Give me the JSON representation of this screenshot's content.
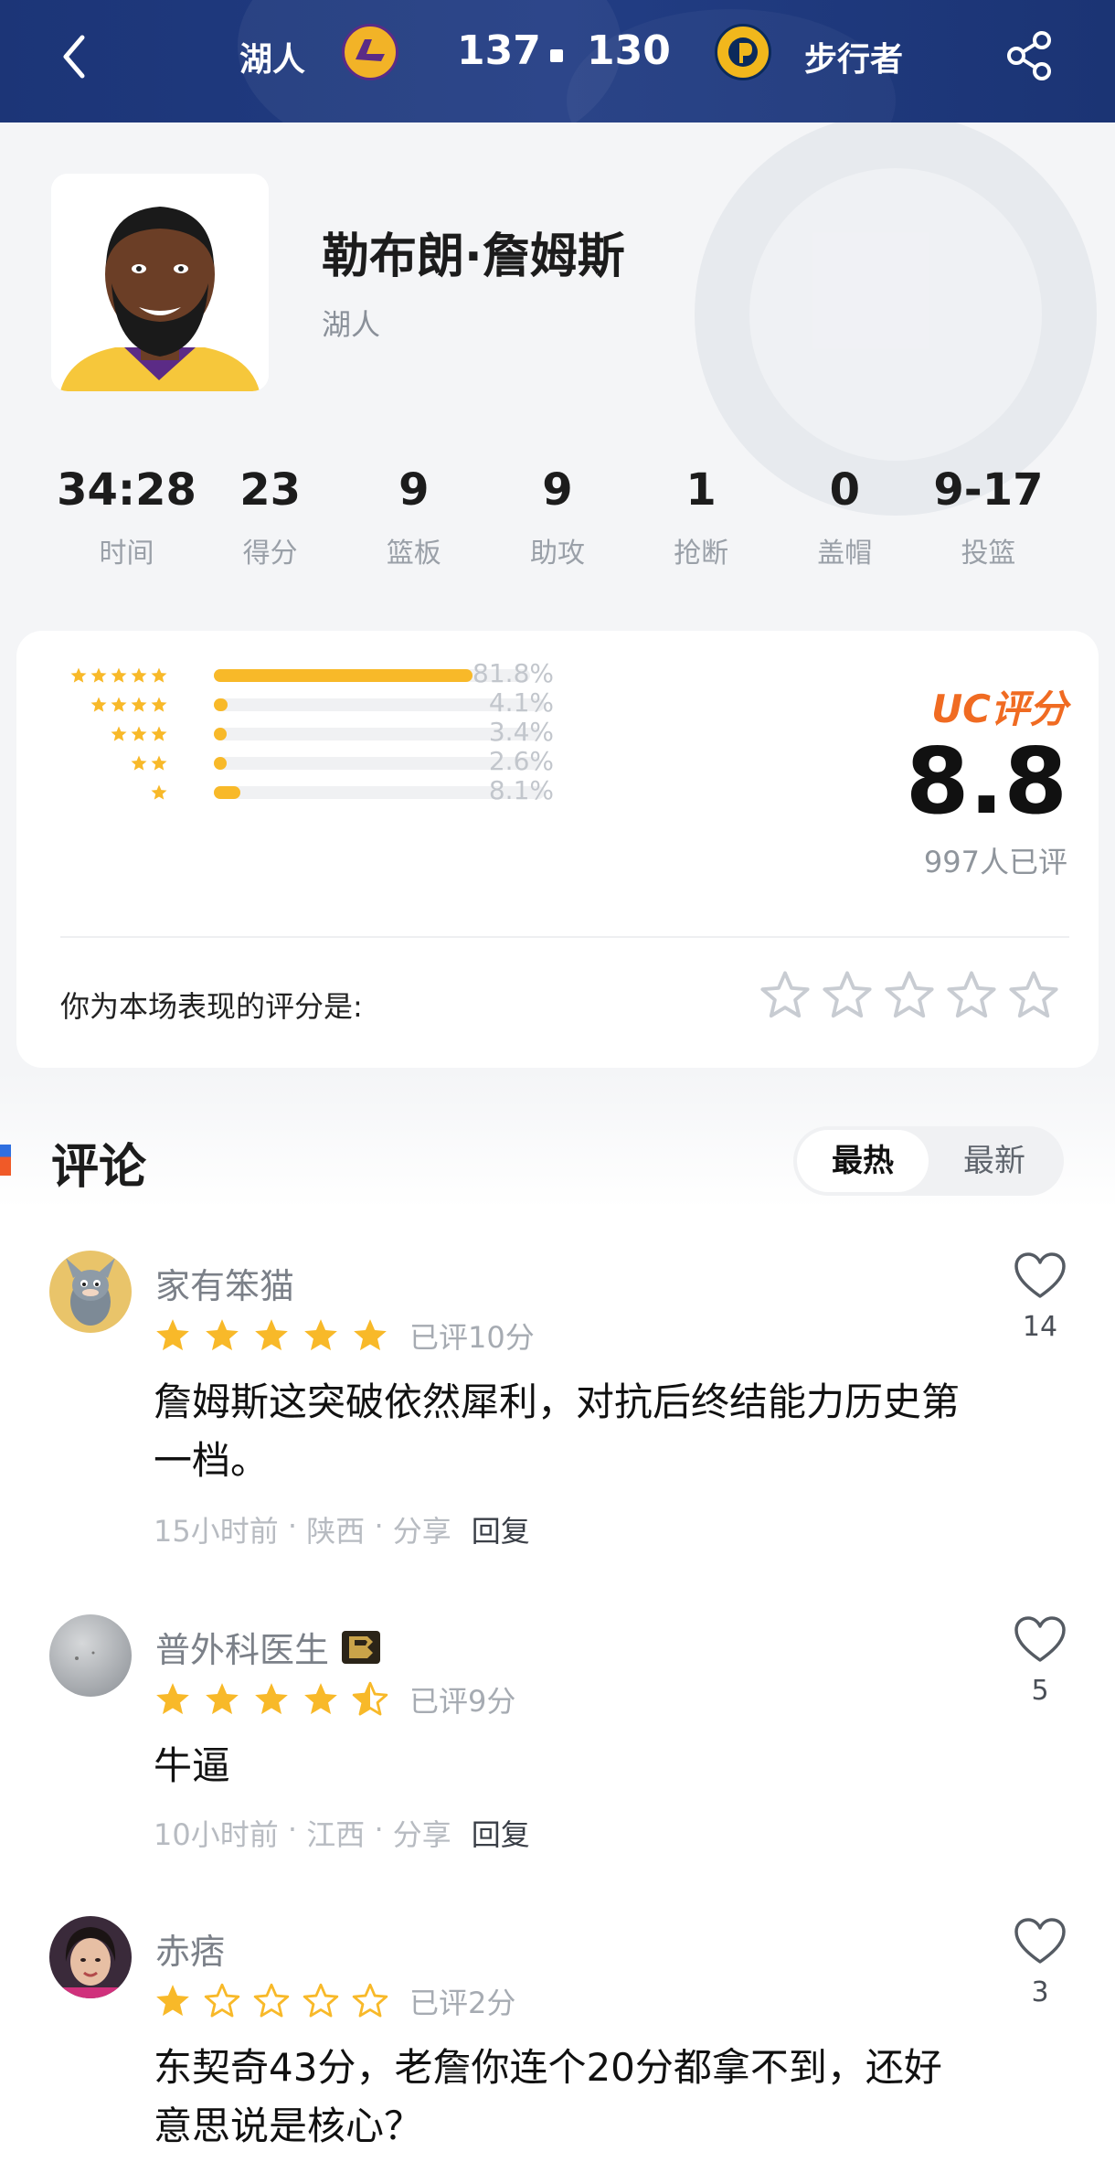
{
  "header": {
    "home_team": "湖人",
    "home_score": "137",
    "away_score": "130",
    "away_team": "步行者"
  },
  "player": {
    "name": "勒布朗·詹姆斯",
    "team": "湖人"
  },
  "stats": [
    {
      "value": "34:28",
      "label": "时间"
    },
    {
      "value": "23",
      "label": "得分"
    },
    {
      "value": "9",
      "label": "篮板"
    },
    {
      "value": "9",
      "label": "助攻"
    },
    {
      "value": "1",
      "label": "抢断"
    },
    {
      "value": "0",
      "label": "盖帽"
    },
    {
      "value": "9-17",
      "label": "投篮"
    }
  ],
  "rating": {
    "title": "UC评分",
    "score": "8.8",
    "count": "997人已评",
    "distribution": [
      {
        "stars": 5,
        "percent": "81.8%",
        "fraction": 0.818
      },
      {
        "stars": 4,
        "percent": "4.1%",
        "fraction": 0.041
      },
      {
        "stars": 3,
        "percent": "3.4%",
        "fraction": 0.034
      },
      {
        "stars": 2,
        "percent": "2.6%",
        "fraction": 0.026
      },
      {
        "stars": 1,
        "percent": "8.1%",
        "fraction": 0.081
      }
    ],
    "your_rating_label": "你为本场表现的评分是:",
    "your_rating_value": 0
  },
  "comments_section": {
    "title": "评论",
    "sort_tabs": [
      "最热",
      "最新"
    ],
    "active_sort": "最热"
  },
  "comments": [
    {
      "user": "家有笨猫",
      "stars": 5,
      "rating_text": "已评10分",
      "body": "詹姆斯这突破依然犀利，对抗后终结能力历史第一档。",
      "time": "15小时前",
      "location": "陕西",
      "share": "分享",
      "reply": "回复",
      "likes": "14"
    },
    {
      "user": "普外科医生",
      "stars": 4.5,
      "rating_text": "已评9分",
      "body": "牛逼",
      "time": "10小时前",
      "location": "江西",
      "share": "分享",
      "reply": "回复",
      "likes": "5"
    },
    {
      "user": "赤痞",
      "stars": 1,
      "rating_text": "已评2分",
      "body": "东契奇43分，老詹你连个20分都拿不到，还好意思说是核心？",
      "likes": "3"
    }
  ],
  "colors": {
    "header_bg": "#1f3a80",
    "star_gold": "#f8b929",
    "uc_orange": "#f06b22"
  }
}
